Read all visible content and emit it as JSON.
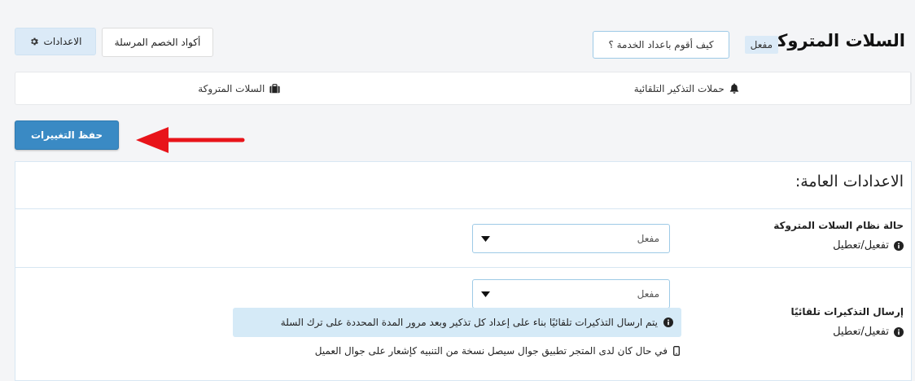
{
  "header": {
    "title": "السلات المتروكة",
    "status_badge": "مفعل",
    "help_button": "كيف أقوم باعداد الخدمة ؟",
    "settings_button": "الاعدادات",
    "sent_codes_button": "أكواد الخصم المرسلة"
  },
  "tabs": [
    {
      "label": "السلات المتروكة",
      "icon": "briefcase-icon"
    },
    {
      "label": "حملات التذكير التلقائية",
      "icon": "bell-icon"
    }
  ],
  "save_button": "حفظ التغييرات",
  "general_settings": {
    "title": "الاعدادات العامة:",
    "system_status": {
      "label": "حالة نظام السلات المتروكة",
      "hint": "تفعيل/تعطيل",
      "selected": "مفعل"
    },
    "auto_reminders": {
      "label": "إرسال التذكيرات تلقائيًا",
      "hint": "تفعيل/تعطيل",
      "selected": "مفعل",
      "info": "يتم ارسال التذكيرات تلقائيًا بناء على إعداد كل تذكير وبعد مرور المدة المحددة على ترك السلة",
      "phone_note": "في حال كان لدى المتجر تطبيق جوال سيصل نسخة من التنبيه كإشعار على جوال العميل"
    }
  },
  "colors": {
    "primary": "#3a8ac4",
    "badge_bg": "#dbeaf7",
    "info_bg": "#d5eaf7",
    "arrow": "#e8141a"
  }
}
